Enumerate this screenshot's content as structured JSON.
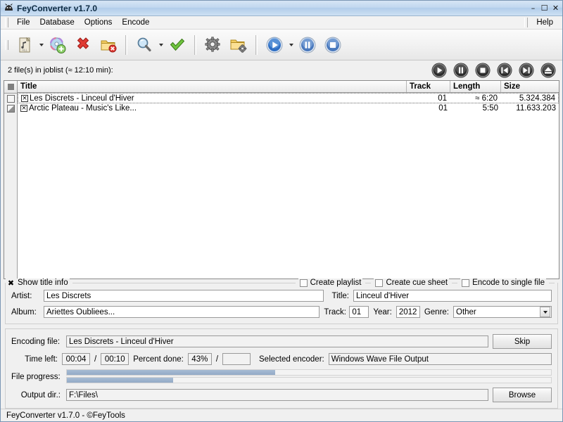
{
  "window": {
    "title": "FeyConverter v1.7.0",
    "icon": "app-logo-icon",
    "minimize": "–",
    "maximize": "☐",
    "close": "✕"
  },
  "menubar": {
    "items": [
      "File",
      "Database",
      "Options",
      "Encode"
    ],
    "right_items": [
      "Help"
    ]
  },
  "toolbar": {
    "buttons": [
      {
        "name": "add-files-button",
        "icon": "music-file-icon"
      },
      {
        "name": "add-files-dropdown",
        "icon": "chevron-down-icon"
      },
      {
        "name": "add-cd-button",
        "icon": "cd-add-icon"
      },
      {
        "name": "remove-button",
        "icon": "red-x-icon"
      },
      {
        "name": "clear-list-button",
        "icon": "folder-delete-icon"
      },
      {
        "name": "search-button",
        "icon": "magnifier-icon"
      },
      {
        "name": "search-dropdown",
        "icon": "chevron-down-icon"
      },
      {
        "name": "apply-button",
        "icon": "green-check-icon"
      },
      {
        "name": "settings-button",
        "icon": "gear-icon"
      },
      {
        "name": "folder-settings-button",
        "icon": "folder-gear-icon"
      },
      {
        "name": "encode-button",
        "icon": "blue-play-icon"
      },
      {
        "name": "encode-dropdown",
        "icon": "chevron-down-icon"
      },
      {
        "name": "pause-encode-button",
        "icon": "blue-pause-icon"
      },
      {
        "name": "stop-encode-button",
        "icon": "blue-stop-icon"
      }
    ]
  },
  "joblist": {
    "count_label": "2 file(s) in joblist (≈ 12:10 min):",
    "media_buttons": [
      {
        "name": "media-play-button",
        "icon": "play-icon"
      },
      {
        "name": "media-pause-button",
        "icon": "pause-icon"
      },
      {
        "name": "media-stop-button",
        "icon": "stop-icon"
      },
      {
        "name": "media-previous-button",
        "icon": "previous-track-icon"
      },
      {
        "name": "media-next-button",
        "icon": "next-track-icon"
      },
      {
        "name": "media-eject-button",
        "icon": "eject-icon"
      }
    ],
    "columns": [
      "Title",
      "Track",
      "Length",
      "Size"
    ],
    "gutter_states": [
      "unchecked",
      "partial"
    ],
    "rows": [
      {
        "checkmark": "×",
        "title": "Les Discrets - Linceul d'Hiver",
        "track": "01",
        "length": "≈ 6:20",
        "size": "5.324.384",
        "focused": true
      },
      {
        "checkmark": "×",
        "title": "Arctic Plateau - Music's Like...",
        "track": "01",
        "length": "5:50",
        "size": "11.633.203",
        "focused": false
      }
    ]
  },
  "title_info": {
    "show_title_info": {
      "label": "Show title info",
      "checked": true,
      "mark": "✖"
    },
    "create_playlist": {
      "label": "Create playlist",
      "checked": false
    },
    "create_cue_sheet": {
      "label": "Create cue sheet",
      "checked": false
    },
    "encode_to_single_file": {
      "label": "Encode to single file",
      "checked": false
    },
    "artist": {
      "label": "Artist:",
      "value": "Les Discrets"
    },
    "title": {
      "label": "Title:",
      "value": "Linceul d'Hiver"
    },
    "album": {
      "label": "Album:",
      "value": "Ariettes Oubliees..."
    },
    "track": {
      "label": "Track:",
      "value": "01"
    },
    "year": {
      "label": "Year:",
      "value": "2012"
    },
    "genre": {
      "label": "Genre:",
      "value": "Other"
    }
  },
  "encoding": {
    "encoding_file": {
      "label": "Encoding file:",
      "value": "Les Discrets - Linceul d'Hiver"
    },
    "skip_button": "Skip",
    "time_left": {
      "label": "Time left:",
      "value": "00:04",
      "separator": "/",
      "total": "00:10"
    },
    "percent_done": {
      "label": "Percent done:",
      "value": "43%",
      "separator": "/",
      "total": ""
    },
    "selected_encoder": {
      "label": "Selected encoder:",
      "value": "Windows Wave File Output"
    },
    "file_progress": {
      "label": "File progress:",
      "file_percent": 43,
      "total_percent": 22
    },
    "output_dir": {
      "label": "Output dir.:",
      "value": "F:\\Files\\"
    },
    "browse_button": "Browse"
  },
  "statusbar": {
    "text": "FeyConverter v1.7.0 - ©FeyTools"
  },
  "colors": {
    "progress_fill": "#93aac6",
    "titlebar": "#b2cdea",
    "accent_blue": "#3c6fb4"
  }
}
